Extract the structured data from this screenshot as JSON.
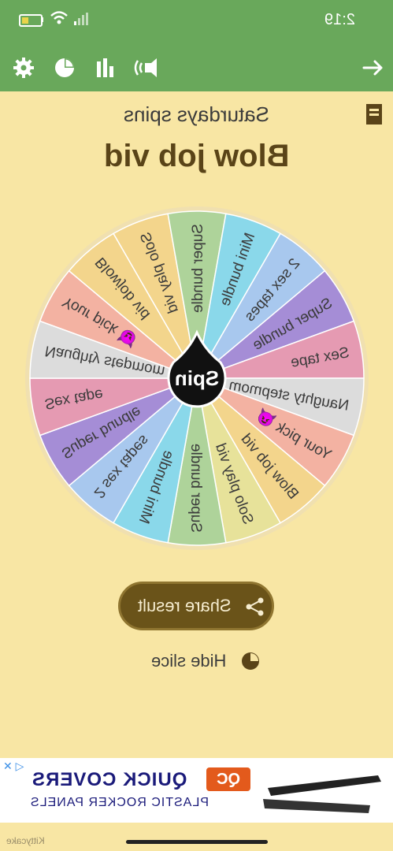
{
  "status": {
    "time": "2:19"
  },
  "header": {
    "subtitle": "Saturdays spins",
    "title": "Blow job vid"
  },
  "wheel": {
    "center_label": "Spin",
    "slices": [
      {
        "label": "Solo play vid",
        "color": "#f3d58c"
      },
      {
        "label": "Super bundle",
        "color": "#aed39a"
      },
      {
        "label": "Mini bundle",
        "color": "#8ad8ea"
      },
      {
        "label": "2 sex tapes",
        "color": "#a8c8ee"
      },
      {
        "label": "Super bundle",
        "color": "#a58dd6"
      },
      {
        "label": "Sex tape",
        "color": "#e59ab2"
      },
      {
        "label": "Naughty stepmom 😈",
        "color": "#dcdcdc"
      },
      {
        "label": "Your pick 😈",
        "color": "#f3b2a2"
      },
      {
        "label": "Blow job vid",
        "color": "#f3d58c"
      },
      {
        "label": "Solo play vid",
        "color": "#e7e29a"
      },
      {
        "label": "Super bundle",
        "color": "#aed39a"
      },
      {
        "label": "Mini bundle",
        "color": "#8ad8ea"
      },
      {
        "label": "2 sex tapes",
        "color": "#a8c8ee"
      },
      {
        "label": "Super bundle",
        "color": "#a58dd6"
      },
      {
        "label": "Sex tape",
        "color": "#e59ab2"
      },
      {
        "label": "Naughty stepmom 😈",
        "color": "#dcdcdc"
      },
      {
        "label": "Your pick 😈",
        "color": "#f3b2a2"
      },
      {
        "label": "Blowjob vid",
        "color": "#f3d58c"
      }
    ]
  },
  "actions": {
    "share_label": "Share result",
    "hide_label": "Hide slice"
  },
  "ad": {
    "headline": "QUICK COVERS",
    "subline": "PLASTIC ROCKER PANELS",
    "logo": "QC"
  },
  "footer": {
    "watermark": "Kittycake"
  }
}
